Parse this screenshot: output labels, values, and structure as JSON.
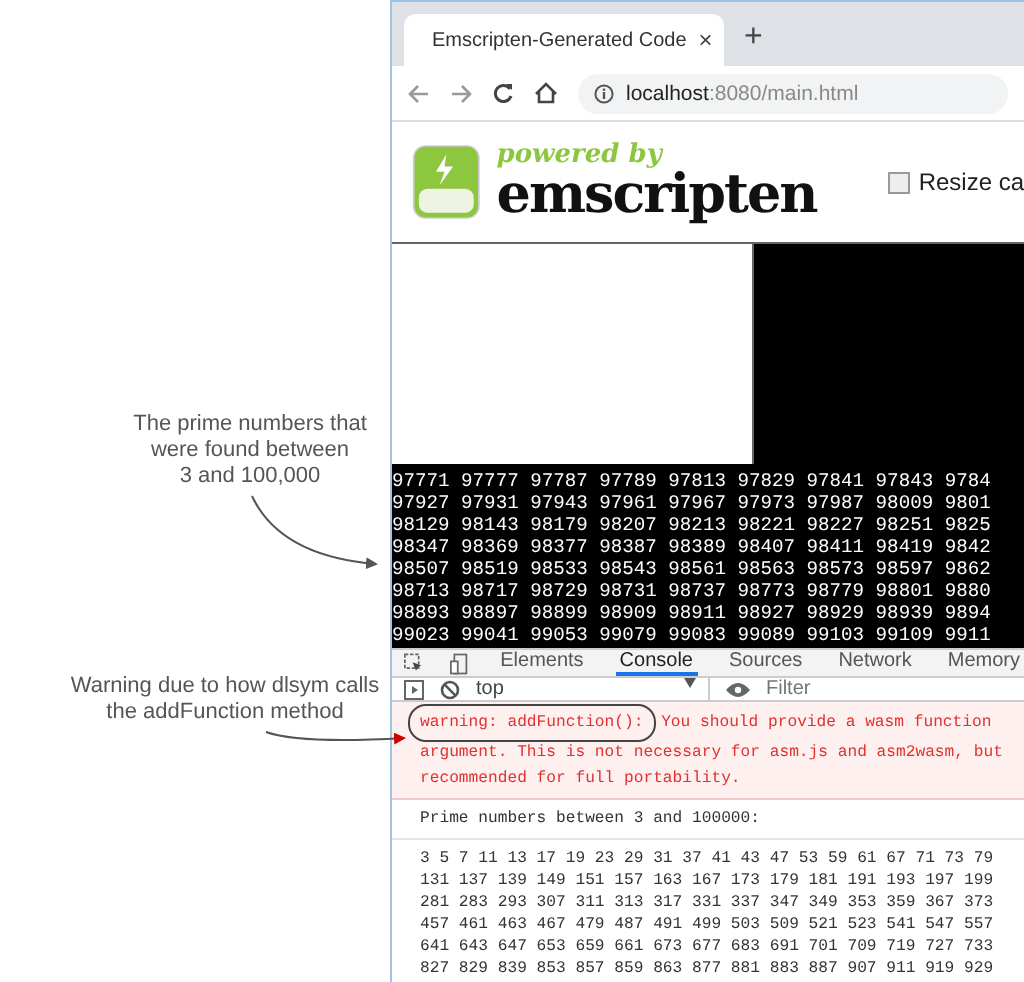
{
  "annotations": [
    {
      "lines": [
        "The prime numbers that",
        "were found between",
        "3 and 100,000"
      ]
    },
    {
      "lines": [
        "Warning due to how dlsym calls",
        "the addFunction method"
      ]
    }
  ],
  "browser": {
    "tab": {
      "title": "Emscripten-Generated Code",
      "close": "×"
    },
    "new_tab": "+",
    "address": {
      "host": "localhost",
      "path": ":8080/main.html"
    }
  },
  "page": {
    "logo": {
      "tagline": "powered by",
      "name": "emscripten"
    },
    "resize_checkbox": {
      "label": "Resize ca",
      "checked": false
    },
    "output_rows": [
      "97771 97777 97787 97789 97813 97829 97841 97843 9784",
      "97927 97931 97943 97961 97967 97973 97987 98009 9801",
      "98129 98143 98179 98207 98213 98221 98227 98251 9825",
      "98347 98369 98377 98387 98389 98407 98411 98419 9842",
      "98507 98519 98533 98543 98561 98563 98573 98597 9862",
      "98713 98717 98729 98731 98737 98773 98779 98801 9880",
      "98893 98897 98899 98909 98911 98927 98929 98939 9894",
      "99023 99041 99053 99079 99083 99089 99103 99109 9911"
    ]
  },
  "devtools": {
    "tabs": [
      {
        "label": "Elements",
        "selected": false
      },
      {
        "label": "Console",
        "selected": true
      },
      {
        "label": "Sources",
        "selected": false
      },
      {
        "label": "Network",
        "selected": false
      },
      {
        "label": "Memory",
        "selected": false
      }
    ],
    "context": "top",
    "filter": {
      "placeholder": "Filter"
    },
    "warning_highlight": "warning: addFunction():",
    "warning_lines": [
      " You should provide a wasm function",
      "argument. This is not necessary for asm.js and asm2wasm, but",
      "recommended for full portability."
    ],
    "message": "Prime numbers between 3 and 100000:",
    "prime_lines": [
      "3 5 7 11 13 17 19 23 29 31 37 41 43 47 53 59 61 67 71 73 79",
      "131 137 139 149 151 157 163 167 173 179 181 191 193 197 199",
      "281 283 293 307 311 313 317 331 337 347 349 353 359 367 373",
      "457 461 463 467 479 487 491 499 503 509 521 523 541 547 557",
      "641 643 647 653 659 661 673 677 683 691 701 709 719 727 733",
      "827 829 839 853 857 859 863 877 881 883 887 907 911 919 929"
    ]
  }
}
